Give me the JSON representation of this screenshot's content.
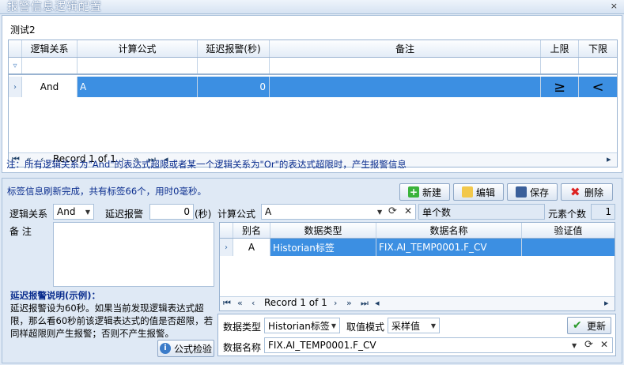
{
  "window": {
    "title": "报警信息逻辑配置",
    "close": "×"
  },
  "caption": "测试2",
  "grid": {
    "columns": [
      "逻辑关系",
      "计算公式",
      "延迟报警(秒)",
      "备注",
      "上限",
      "下限"
    ],
    "row": {
      "logic": "And",
      "formula": "A",
      "delay": "0",
      "remark": "",
      "upper": "≥",
      "lower": "<"
    },
    "nav": "Record 1 of 1"
  },
  "note": "注：所有逻辑关系为\"And\"的表达式超限或者某一个逻辑关系为\"Or\"的表达式超限时，产生报警信息",
  "status": "标签信息刷新完成，共有标签66个，用时0毫秒。",
  "buttons": {
    "new": "新建",
    "edit": "编辑",
    "save": "保存",
    "delete": "删除",
    "check": "公式检验",
    "update": "更新"
  },
  "form": {
    "logic_label": "逻辑关系",
    "logic_value": "And",
    "delay_label": "延迟报警",
    "delay_value": "0",
    "delay_unit": "(秒)",
    "remark_label": "备 注",
    "formula_label": "计算公式",
    "formula_value": "A",
    "type_label": "单个数",
    "count_label": "元素个数",
    "count_value": "1"
  },
  "help": {
    "title": "延迟报警说明(示例)：",
    "body": "延迟报警设为60秒。如果当前发现逻辑表达式超限，那么看60秒前该逻辑表达式的值是否超限，若同样超限则产生报警；否则不产生报警。"
  },
  "grid2": {
    "columns": [
      "别名",
      "数据类型",
      "数据名称",
      "验证值"
    ],
    "row": {
      "alias": "A",
      "dtype": "Historian标签",
      "dname": "FIX.AI_TEMP0001.F_CV",
      "verify": ""
    },
    "nav": "Record 1 of 1"
  },
  "bottom": {
    "dtype_label": "数据类型",
    "dtype_value": "Historian标签",
    "mode_label": "取值模式",
    "mode_value": "采样值",
    "dname_label": "数据名称",
    "dname_value": "FIX.AI_TEMP0001.F_CV"
  }
}
